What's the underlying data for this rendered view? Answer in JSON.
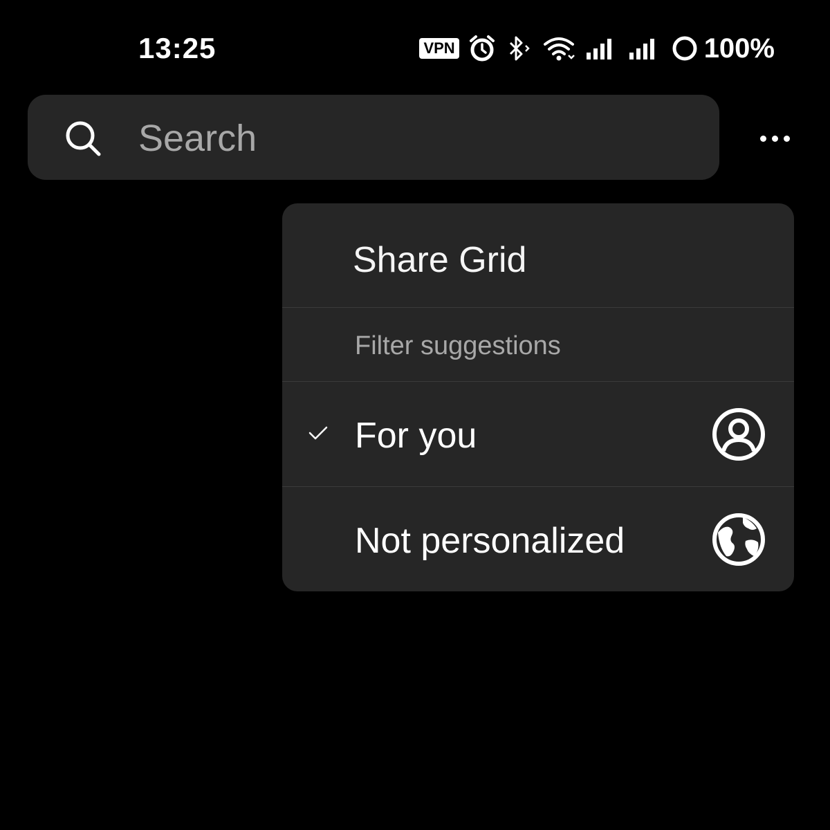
{
  "status_bar": {
    "time": "13:25",
    "vpn_label": "VPN",
    "battery": "100%",
    "icons": [
      "vpn-icon",
      "alarm-icon",
      "bluetooth-icon",
      "wifi-icon",
      "signal-icon",
      "signal-icon",
      "battery-ring-icon"
    ]
  },
  "search": {
    "placeholder": "Search",
    "icon": "search-icon"
  },
  "header": {
    "more_icon": "more-horizontal-icon"
  },
  "menu": {
    "share_grid_label": "Share Grid",
    "filter_header": "Filter suggestions",
    "options": [
      {
        "label": "For you",
        "selected": true,
        "icon": "user-circle-icon"
      },
      {
        "label": "Not personalized",
        "selected": false,
        "icon": "globe-icon"
      }
    ]
  },
  "colors": {
    "background": "#000000",
    "surface": "#262626",
    "divider": "#3a3a3a",
    "muted_text": "#a8a8a8",
    "text": "#ffffff"
  }
}
